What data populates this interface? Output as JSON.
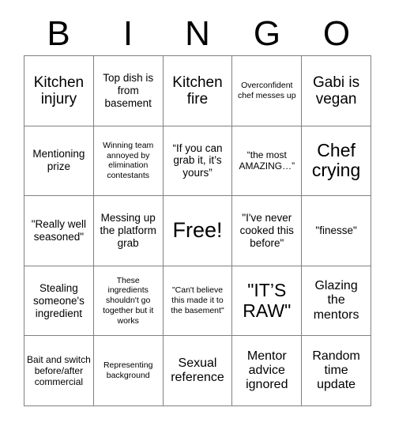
{
  "card": {
    "header_letters": [
      "B",
      "I",
      "N",
      "G",
      "O"
    ],
    "rows": [
      [
        {
          "text": "Kitchen injury",
          "size": "fs-xl"
        },
        {
          "text": "Top dish is from basement",
          "size": "fs-md"
        },
        {
          "text": "Kitchen fire",
          "size": "fs-xl"
        },
        {
          "text": "Overconfident chef messes up",
          "size": "fs-xs"
        },
        {
          "text": "Gabi is vegan",
          "size": "fs-xl"
        }
      ],
      [
        {
          "text": "Mentioning prize",
          "size": "fs-md"
        },
        {
          "text": "Winning team annoyed by elimination contestants",
          "size": "fs-xs"
        },
        {
          "text": "“If you can grab it, it’s yours”",
          "size": "fs-md"
        },
        {
          "text": "“the most AMAZING…”",
          "size": "fs-sm"
        },
        {
          "text": "Chef crying",
          "size": "fs-xxl"
        }
      ],
      [
        {
          "text": "\"Really well seasoned\"",
          "size": "fs-md"
        },
        {
          "text": "Messing up the platform grab",
          "size": "fs-md"
        },
        {
          "text": "Free!",
          "size": "fs-free"
        },
        {
          "text": "\"I've never cooked this before\"",
          "size": "fs-md"
        },
        {
          "text": "\"finesse\"",
          "size": "fs-md"
        }
      ],
      [
        {
          "text": "Stealing someone's ingredient",
          "size": "fs-md"
        },
        {
          "text": "These ingredients shouldn't go together but it works",
          "size": "fs-xs"
        },
        {
          "text": "\"Can't believe this made it to the basement\"",
          "size": "fs-xs"
        },
        {
          "text": "\"IT’S RAW\"",
          "size": "fs-xxl"
        },
        {
          "text": "Glazing the mentors",
          "size": "fs-lg"
        }
      ],
      [
        {
          "text": "Bait and switch before/after commercial",
          "size": "fs-sm"
        },
        {
          "text": "Representing background",
          "size": "fs-xs"
        },
        {
          "text": "Sexual reference",
          "size": "fs-lg"
        },
        {
          "text": "Mentor advice ignored",
          "size": "fs-lg"
        },
        {
          "text": "Random time update",
          "size": "fs-lg"
        }
      ]
    ]
  }
}
